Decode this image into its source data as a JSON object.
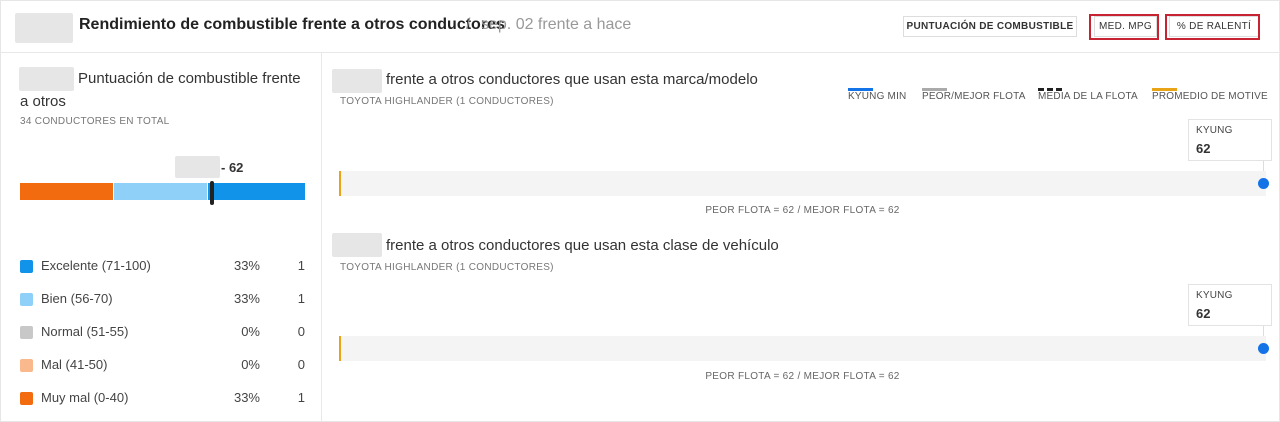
{
  "header": {
    "title": "Rendimiento de combustible frente a otros conductores",
    "separator": "/",
    "subtitle": "sep. 02 frente a hace",
    "tabs": [
      {
        "label": "PUNTUACIÓN DE COMBUSTIBLE"
      },
      {
        "label": "MED. MPG"
      },
      {
        "label": "% DE RALENTÍ"
      }
    ]
  },
  "left": {
    "title_line1": "Puntuación de combustible frente",
    "title_line2": "a otros",
    "total": "34 CONDUCTORES EN TOTAL",
    "score_label": "- 62",
    "score_value": 62,
    "bar_segments": [
      {
        "color": "#f26b0f",
        "from": 0,
        "to": 33
      },
      {
        "color": "#8fd0f8",
        "from": 33,
        "to": 66
      },
      {
        "color": "#1193ea",
        "from": 66,
        "to": 100
      }
    ],
    "legend": [
      {
        "label": "Excelente (71-100)",
        "pct": "33%",
        "count": "1",
        "color": "#1193ea"
      },
      {
        "label": "Bien (56-70)",
        "pct": "33%",
        "count": "1",
        "color": "#8fd0f8"
      },
      {
        "label": "Normal (51-55)",
        "pct": "0%",
        "count": "0",
        "color": "#c8c8c8"
      },
      {
        "label": "Mal (41-50)",
        "pct": "0%",
        "count": "0",
        "color": "#f9b98c"
      },
      {
        "label": "Muy mal (0-40)",
        "pct": "33%",
        "count": "1",
        "color": "#f26b0f"
      }
    ]
  },
  "legend_top": [
    {
      "label": "KYUNG MIN",
      "color": "#1473e6",
      "style": "solid"
    },
    {
      "label": "PEOR/MEJOR FLOTA",
      "color": "#aaaaaa",
      "style": "solid"
    },
    {
      "label": "MEDIA DE LA FLOTA",
      "color": "#222222",
      "style": "dashed"
    },
    {
      "label": "PROMEDIO DE MOTIVE",
      "color": "#e8a316",
      "style": "solid"
    }
  ],
  "sections": [
    {
      "title": "frente a otros conductores que usan esta marca/modelo",
      "subtitle": "TOYOTA HIGHLANDER (1 CONDUCTORES)",
      "driver_label": "KYUNG",
      "driver_value": "62",
      "caption": "PEOR FLOTA = 62 / MEJOR FLOTA = 62"
    },
    {
      "title": "frente a otros conductores que usan esta clase de vehículo",
      "subtitle": "TOYOTA HIGHLANDER (1 CONDUCTORES)",
      "driver_label": "KYUNG",
      "driver_value": "62",
      "caption": "PEOR FLOTA = 62 / MEJOR FLOTA = 62"
    }
  ]
}
